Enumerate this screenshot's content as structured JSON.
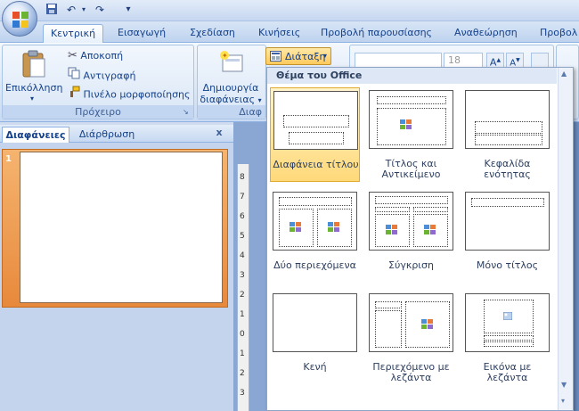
{
  "quick_access": {
    "save": "save-icon",
    "undo": "undo-icon",
    "redo": "redo-icon",
    "customize": "▾"
  },
  "tabs": [
    {
      "label": "Κεντρική"
    },
    {
      "label": "Εισαγωγή"
    },
    {
      "label": "Σχεδίαση"
    },
    {
      "label": "Κινήσεις"
    },
    {
      "label": "Προβολή παρουσίασης"
    },
    {
      "label": "Αναθεώρηση"
    },
    {
      "label": "Προβολ"
    }
  ],
  "clipboard": {
    "paste": "Επικόλληση",
    "cut": "Αποκοπή",
    "copy": "Αντιγραφή",
    "format_painter": "Πινέλο μορφοποίησης",
    "group_label": "Πρόχειρο"
  },
  "slides": {
    "new_slide_line1": "Δημιουργία",
    "new_slide_line2": "διαφάνειας",
    "layout_button": "Διάταξη",
    "group_label": "Διαφ"
  },
  "font": {
    "size": "18"
  },
  "panel": {
    "tab_slides": "Διαφάνειες",
    "tab_outline": "Διάρθρωση",
    "close": "x",
    "slide_number": "1"
  },
  "ruler_numbers": [
    "8",
    "7",
    "6",
    "5",
    "4",
    "3",
    "2",
    "1",
    "0",
    "1",
    "2",
    "3"
  ],
  "layout_gallery": {
    "header": "Θέμα του Office",
    "items": [
      {
        "label": "Διαφάνεια τίτλου"
      },
      {
        "label": "Τίτλος και Αντικείμενο"
      },
      {
        "label": "Κεφαλίδα ενότητας"
      },
      {
        "label": "Δύο περιεχόμενα"
      },
      {
        "label": "Σύγκριση"
      },
      {
        "label": "Μόνο τίτλος"
      },
      {
        "label": "Κενή"
      },
      {
        "label": "Περιεχόμενο με λεζάντα"
      },
      {
        "label": "Εικόνα με λεζάντα"
      }
    ]
  },
  "colors": {
    "accent": "#15428b",
    "selected": "#ffd97a",
    "slide_selected": "#e8893c"
  }
}
